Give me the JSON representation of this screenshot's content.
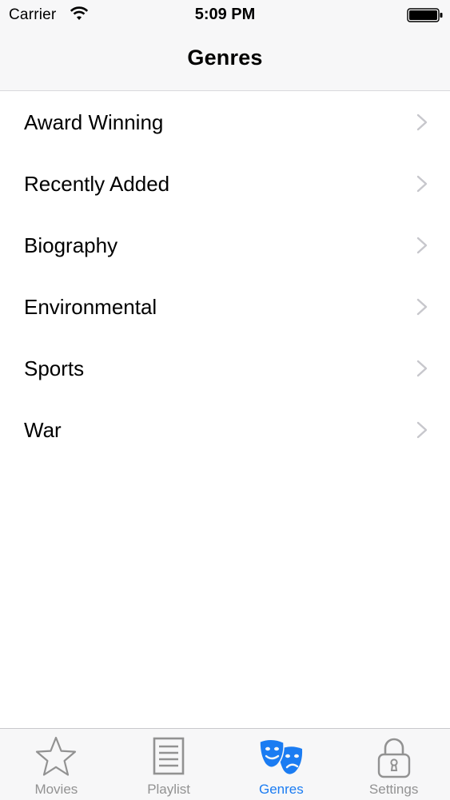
{
  "status_bar": {
    "carrier": "Carrier",
    "time": "5:09 PM",
    "wifi_icon": "wifi-icon",
    "battery_icon": "battery-icon"
  },
  "nav": {
    "title": "Genres"
  },
  "genres": [
    {
      "label": "Award Winning"
    },
    {
      "label": "Recently Added"
    },
    {
      "label": "Biography"
    },
    {
      "label": "Environmental"
    },
    {
      "label": "Sports"
    },
    {
      "label": "War"
    }
  ],
  "tab_bar": {
    "tabs": [
      {
        "label": "Movies",
        "icon": "star-icon",
        "active": false
      },
      {
        "label": "Playlist",
        "icon": "list-icon",
        "active": false
      },
      {
        "label": "Genres",
        "icon": "theater-masks-icon",
        "active": true
      },
      {
        "label": "Settings",
        "icon": "lock-icon",
        "active": false
      }
    ]
  },
  "colors": {
    "accent": "#1b7cf2",
    "inactive_tab": "#929292",
    "bar_background": "#f7f7f8",
    "chevron": "#c7c7cc"
  }
}
